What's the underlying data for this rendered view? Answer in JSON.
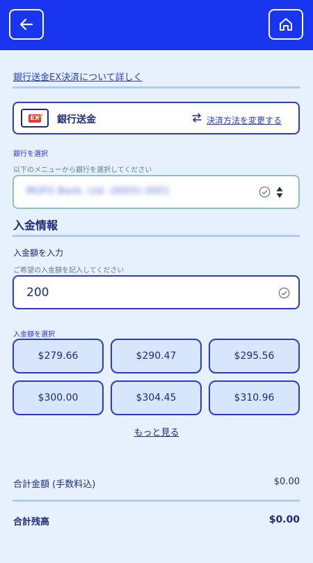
{
  "colors": {
    "header": "#1a35f0",
    "accent": "#2a3bc7",
    "background": "#e6f1fd",
    "select_border": "#8fc5b0"
  },
  "header": {
    "back_icon": "arrow-left-icon",
    "home_icon": "home-icon"
  },
  "info_link": "銀行送金EX決済について詳しく",
  "payment_method": {
    "logo_text": "EX",
    "name": "銀行送金",
    "swap_icon": "swap-arrows-icon",
    "change_link": "決済方法を変更する"
  },
  "bank": {
    "label": "銀行を選択",
    "hint": "以下のメニューから銀行を選択してください",
    "value": "MUFG Bank, Ltd. (0005) 0001"
  },
  "deposit": {
    "section_title": "入金情報",
    "amount_label": "入金額を入力",
    "amount_hint": "ご希望の入金額を記入してください",
    "amount_value": "200",
    "preset_label": "入金額を選択",
    "presets": [
      "$279.66",
      "$290.47",
      "$295.56",
      "$300.00",
      "$304.45",
      "$310.96"
    ],
    "more_link": "もっと見る"
  },
  "summary": {
    "total_label": "合計金額 (手数料込)",
    "total_value": "$0.00",
    "balance_label": "合計残高",
    "balance_value": "$0.00"
  }
}
